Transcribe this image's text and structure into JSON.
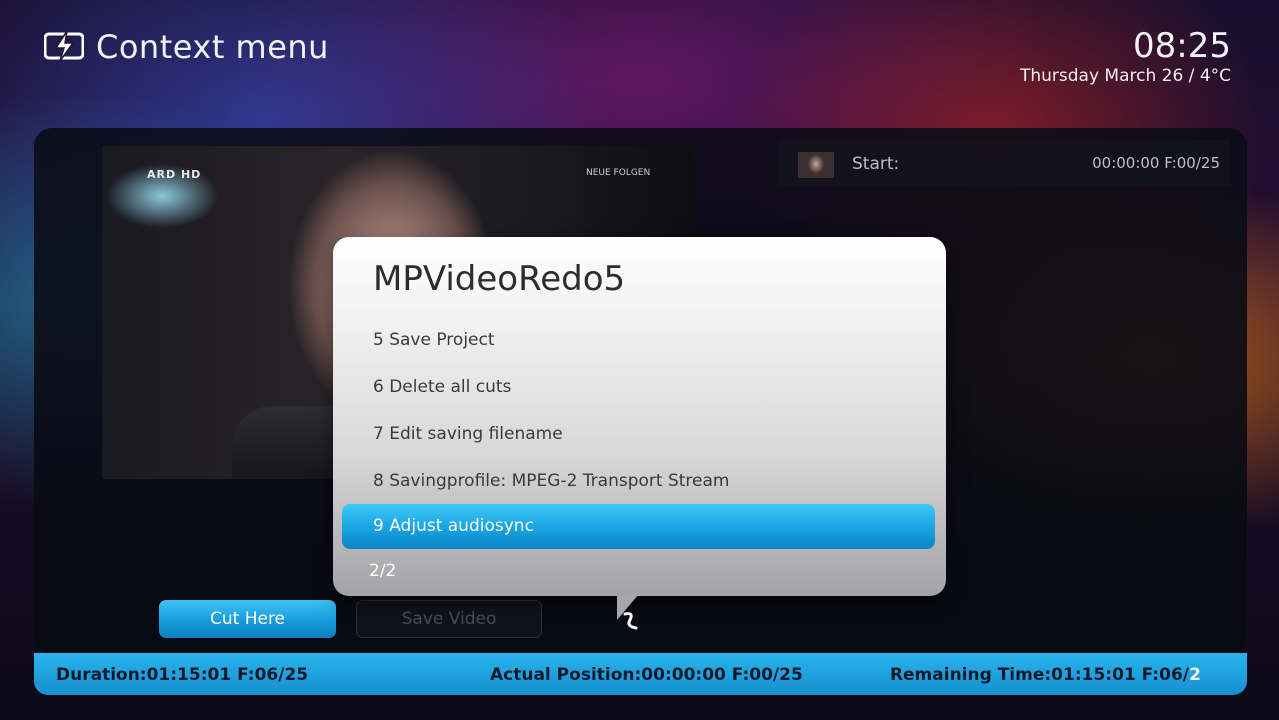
{
  "header": {
    "title": "Context menu",
    "logo_icon": "lightning-icon"
  },
  "clock": {
    "time": "08:25",
    "date": "Thursday March 26 / 4°C"
  },
  "video": {
    "channel_logo": "ARD HD",
    "caption": "NEUE FOLGEN"
  },
  "start": {
    "label": "Start:",
    "value": "00:00:00 F:00/25"
  },
  "buttons": {
    "cut": "Cut Here",
    "save": "Save Video"
  },
  "status": {
    "duration": "Duration:01:15:01 F:06/25",
    "position": "Actual Position:00:00:00 F:00/25",
    "remaining": "Remaining Time:01:15:01 F:06/",
    "remaining_tail": "2"
  },
  "dialog": {
    "title": "MPVideoRedo5",
    "items": [
      {
        "label": "5 Save Project"
      },
      {
        "label": "6 Delete all cuts"
      },
      {
        "label": "7 Edit saving filename"
      },
      {
        "label": "8 Savingprofile: MPEG-2 Transport Stream"
      },
      {
        "label": "9 Adjust audiosync"
      }
    ],
    "selected_index": 4,
    "page": "2/2"
  },
  "colors": {
    "accent": "#1aa6e4",
    "status_bar": "#2ab4ee"
  }
}
